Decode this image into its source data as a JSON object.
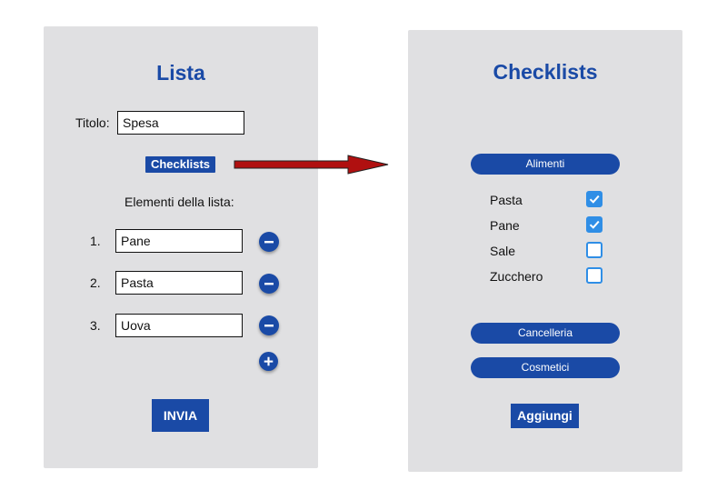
{
  "left": {
    "title": "Lista",
    "titolo_label": "Titolo:",
    "titolo_value": "Spesa",
    "checklists_button": "Checklists",
    "elements_label": "Elementi della lista:",
    "items": [
      {
        "number": "1.",
        "value": "Pane"
      },
      {
        "number": "2.",
        "value": "Pasta"
      },
      {
        "number": "3.",
        "value": "Uova"
      }
    ],
    "submit_label": "INVIA"
  },
  "right": {
    "title": "Checklists",
    "categories": [
      {
        "label": "Alimenti"
      },
      {
        "label": "Cancelleria"
      },
      {
        "label": "Cosmetici"
      }
    ],
    "checklist": [
      {
        "label": "Pasta",
        "checked": true
      },
      {
        "label": "Pane",
        "checked": true
      },
      {
        "label": "Sale",
        "checked": false
      },
      {
        "label": "Zucchero",
        "checked": false
      }
    ],
    "add_label": "Aggiungi"
  },
  "colors": {
    "primary": "#1a4aa6",
    "checkbox": "#2f8ee6",
    "arrow": "#b01010",
    "panel": "#e0e0e2"
  },
  "icons": [
    "minus-icon",
    "plus-icon",
    "checkmark-icon",
    "arrow-icon"
  ]
}
